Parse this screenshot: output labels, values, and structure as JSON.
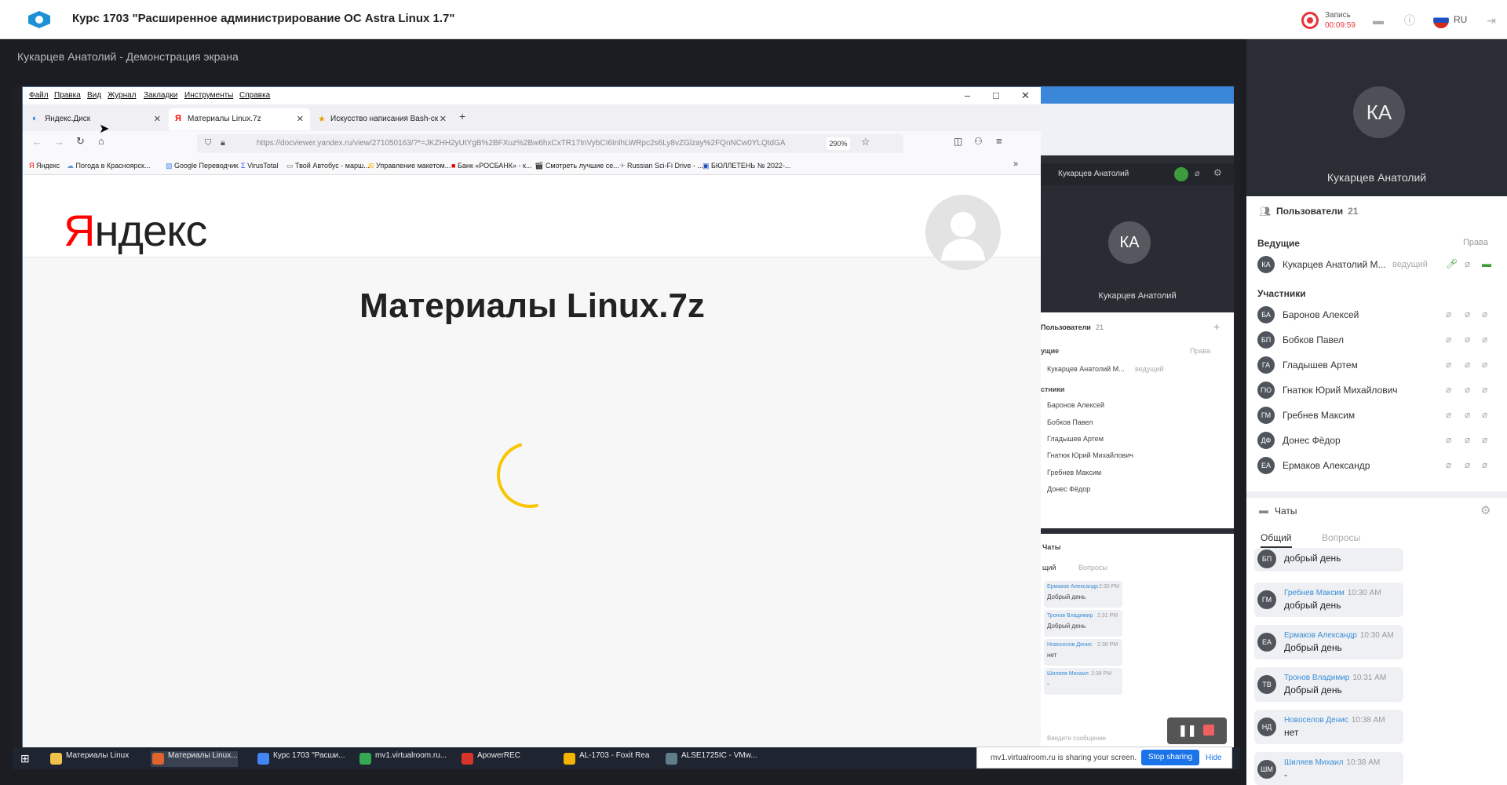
{
  "app": {
    "course_title": "Курс 1703 \"Расширенное администрирование ОС Astra Linux 1.7\"",
    "record_label": "Запись",
    "record_time": "00:09:59",
    "lang": "RU",
    "accent": "#1a73e8",
    "record_color": "#e8333b"
  },
  "demo": {
    "title": "Кукарцев Анатолий - Демонстрация экрана"
  },
  "firefox": {
    "menu": [
      "Файл",
      "Правка",
      "Вид",
      "Журнал",
      "Закладки",
      "Инструменты",
      "Справка"
    ],
    "tabs": [
      {
        "label": "Яндекс.Диск",
        "icon": "yandex-disk-icon",
        "active": false
      },
      {
        "label": "Материалы Linux.7z",
        "icon": "yandex-icon",
        "active": true
      },
      {
        "label": "Искусство написания Bash-ск",
        "icon": "star-icon",
        "active": false
      }
    ],
    "url": "https://docviewer.yandex.ru/view/271050163/?*=JKZHH2yUtYgB%2BFXuz%2Bw6hxCxTR17InVybCI6InlhLWRpc2s6Ly8vZGlzay%2FQnNCw0YLQtdGA",
    "zoom": "290%",
    "bookmarks": [
      "Яндекс",
      "Погода в Красноярск...",
      "Google Переводчик",
      "VirusTotal",
      "Твой Автобус - марш...",
      "Управление макетом...",
      "Банк «РОСБАНК» - к...",
      "Смотреть лучшие се...",
      "Russian Sci-Fi Drive - ...",
      "БЮЛЛЕТЕНЬ № 2022-..."
    ],
    "content": {
      "logo": "Яндекс",
      "logo_first": "Я",
      "logo_rest": "ндекс",
      "file_title": "Материалы Linux.7z"
    }
  },
  "inner_room": {
    "user": "Кукарцев Анатолий",
    "avatar": "КА",
    "users_header": "Пользователи",
    "users_count": "21",
    "host_section": "ущие",
    "rights": "Права",
    "participants_section": "стники",
    "host": {
      "name": "Кукарцев Анатолий М...",
      "role": "ведущий"
    },
    "participants": [
      "Баронов Алексей",
      "Бобков Павел",
      "Гладышев Артем",
      "Гнатюк Юрий Михайлович",
      "Гребнев Максим",
      "Донес Фёдор"
    ],
    "chat_header": "Чаты",
    "tab_common": "щий",
    "tab_questions": "Вопросы",
    "messages": [
      {
        "author": "Ермаков Александр",
        "time": "2:30 PM",
        "text": "Добрый день"
      },
      {
        "author": "Тронов Владимир",
        "time": "2:31 PM",
        "text": "Добрый день"
      },
      {
        "author": "Новоселов Денис",
        "time": "2:38 PM",
        "text": "нет"
      },
      {
        "author": "Шиляев Михаил",
        "time": "2:38 PM",
        "text": "-"
      }
    ],
    "input_placeholder": "Введите сообщение"
  },
  "taskbar": {
    "items": [
      {
        "label": "Материалы Linux",
        "color": "#f2c14b"
      },
      {
        "label": "Материалы Linux...",
        "color": "#e0632c"
      },
      {
        "label": "Курс 1703 \"Расши...",
        "color": "#4285f4"
      },
      {
        "label": "mv1.virtualroom.ru...",
        "color": "#34a853"
      },
      {
        "label": "ApowerREC",
        "color": "#d8342c"
      },
      {
        "label": "AL-1703 - Foxit Rea",
        "color": "#f4b400"
      },
      {
        "label": "ALSE1725IC - VMw...",
        "color": "#607d8b"
      }
    ],
    "share_text": "mv1.virtualroom.ru is sharing your screen.",
    "stop_sharing": "Stop sharing",
    "hide": "Hide"
  },
  "panel": {
    "video_avatar": "КА",
    "video_name": "Кукарцев Анатолий",
    "users_header": "Пользователи",
    "users_count": "21",
    "hosts_label": "Ведущие",
    "rights_label": "Права",
    "participants_label": "Участники",
    "host": {
      "initials": "КА",
      "name": "Кукарцев Анатолий М...",
      "role": "ведущий"
    },
    "participants": [
      {
        "initials": "БА",
        "name": "Баронов Алексей"
      },
      {
        "initials": "БП",
        "name": "Бобков Павел"
      },
      {
        "initials": "ГА",
        "name": "Гладышев Артем"
      },
      {
        "initials": "ГЮ",
        "name": "Гнатюк Юрий Михайлович"
      },
      {
        "initials": "ГМ",
        "name": "Гребнев Максим"
      },
      {
        "initials": "ДФ",
        "name": "Донес Фёдор"
      },
      {
        "initials": "ЕА",
        "name": "Ермаков Александр"
      }
    ],
    "chat_header": "Чаты",
    "tab_common": "Общий",
    "tab_questions": "Вопросы",
    "messages": [
      {
        "initials": "БП",
        "author": "",
        "time": "",
        "text": "добрый день"
      },
      {
        "initials": "ГМ",
        "author": "Гребнев Максим",
        "time": "10:30 AM",
        "text": "добрый день"
      },
      {
        "initials": "ЕА",
        "author": "Ермаков Александр",
        "time": "10:30 AM",
        "text": "Добрый день"
      },
      {
        "initials": "ТВ",
        "author": "Тронов Владимир",
        "time": "10:31 AM",
        "text": "Добрый день"
      },
      {
        "initials": "НД",
        "author": "Новоселов Денис",
        "time": "10:38 AM",
        "text": "нет"
      },
      {
        "initials": "ШМ",
        "author": "Шиляев Михаил",
        "time": "10:38 AM",
        "text": "-"
      }
    ]
  }
}
